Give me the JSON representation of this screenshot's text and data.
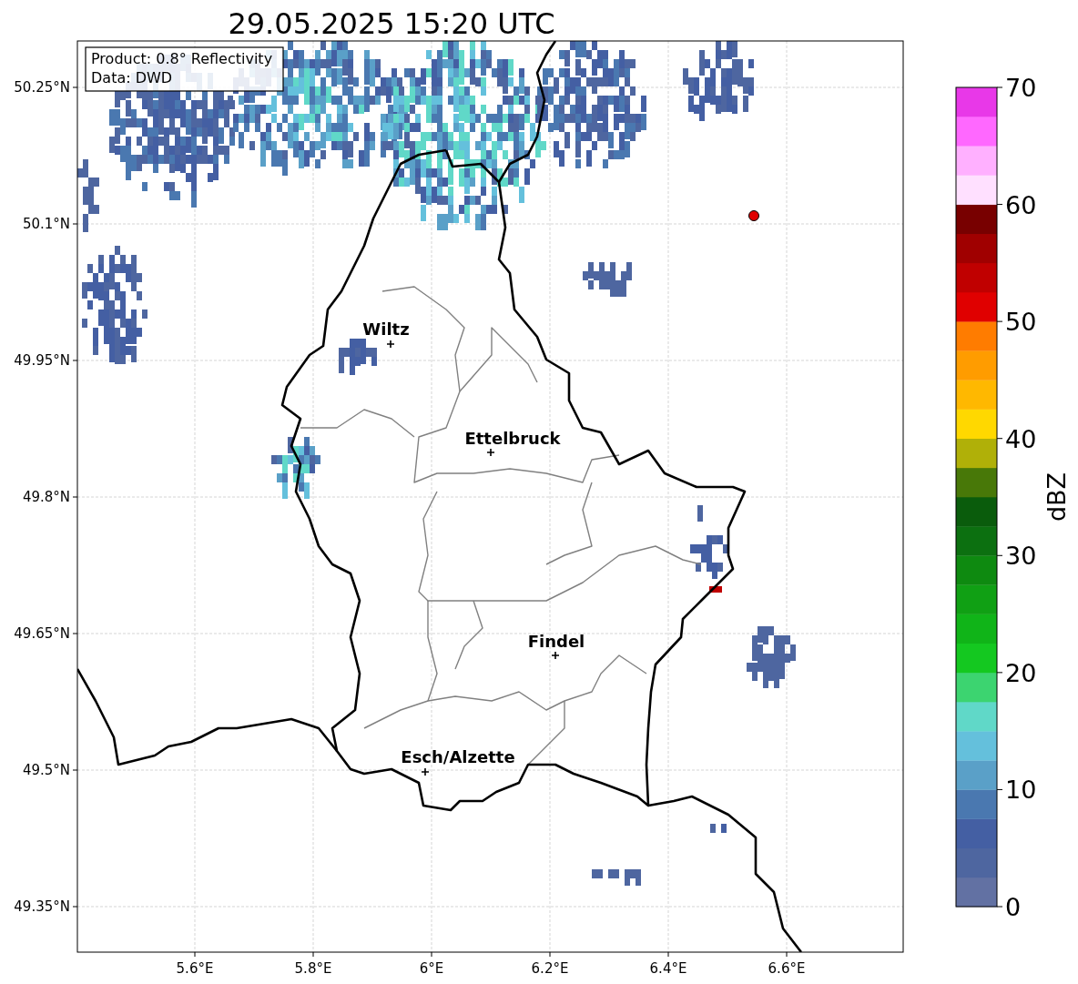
{
  "title": "29.05.2025 15:20 UTC",
  "info_box": [
    "Product: 0.8° Reflectivity",
    "Data: DWD"
  ],
  "map": {
    "lat_ticks": [
      "50.25°N",
      "50.1°N",
      "49.95°N",
      "49.8°N",
      "49.65°N",
      "49.5°N",
      "49.35°N"
    ],
    "lon_ticks": [
      "5.6°E",
      "5.8°E",
      "6°E",
      "6.2°E",
      "6.4°E",
      "6.6°E"
    ],
    "cities": [
      {
        "name": "Wiltz"
      },
      {
        "name": "Ettelbruck"
      },
      {
        "name": "Findel"
      },
      {
        "name": "Esch/Alzette"
      }
    ]
  },
  "colorbar": {
    "label": "dBZ",
    "ticks": [
      "70",
      "60",
      "50",
      "40",
      "30",
      "20",
      "10",
      "0"
    ],
    "segments": [
      {
        "color": "#6271a3"
      },
      {
        "color": "#4e66a0"
      },
      {
        "color": "#445fa3"
      },
      {
        "color": "#4a78b0"
      },
      {
        "color": "#5aa0c8"
      },
      {
        "color": "#64c0dc"
      },
      {
        "color": "#60d8c8"
      },
      {
        "color": "#3cd470"
      },
      {
        "color": "#14c820"
      },
      {
        "color": "#10b418"
      },
      {
        "color": "#10a014"
      },
      {
        "color": "#0e8a10"
      },
      {
        "color": "#0c7010"
      },
      {
        "color": "#0a5c0c"
      },
      {
        "color": "#487808"
      },
      {
        "color": "#b0b008"
      },
      {
        "color": "#ffd800"
      },
      {
        "color": "#ffb800"
      },
      {
        "color": "#ff9c00"
      },
      {
        "color": "#ff7c00"
      },
      {
        "color": "#e00000"
      },
      {
        "color": "#c00000"
      },
      {
        "color": "#a00000"
      },
      {
        "color": "#780000"
      },
      {
        "color": "#ffe0ff"
      },
      {
        "color": "#ffb0ff"
      },
      {
        "color": "#ff68ff"
      },
      {
        "color": "#e838e8"
      }
    ]
  }
}
